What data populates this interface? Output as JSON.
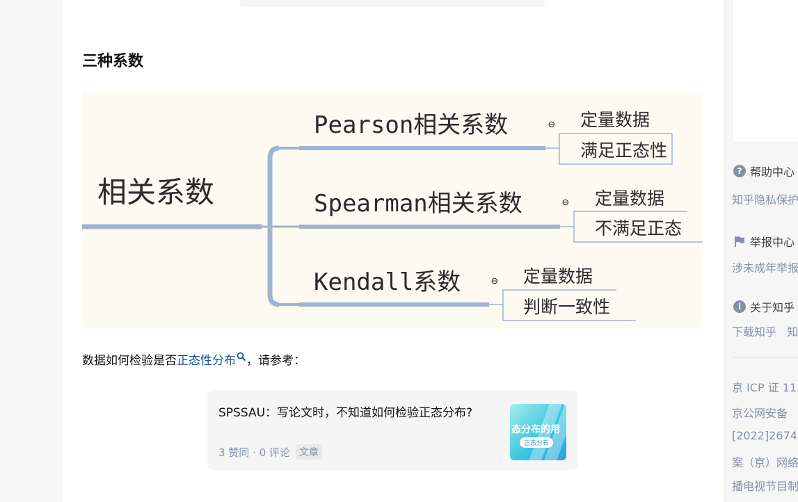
{
  "article": {
    "section_title": "三种系数",
    "mindmap": {
      "root": "相关系数",
      "branches": [
        {
          "label": "Pearson相关系数",
          "items": [
            "定量数据",
            "满足正态性"
          ]
        },
        {
          "label": "Spearman相关系数",
          "items": [
            "定量数据",
            "不满足正态"
          ]
        },
        {
          "label": "Kendall系数",
          "items": [
            "定量数据",
            "判断一致性"
          ]
        }
      ],
      "collapse_glyph": "⊖"
    },
    "paragraph": {
      "before_link": "数据如何检验是否",
      "link_text": "正态性分布",
      "after_link": "，请参考："
    },
    "ref_card": {
      "title": "SPSSAU：写论文时，不知道如何检验正态分布?",
      "meta": "3 赞同 · 0 评论",
      "tag": "文章",
      "thumb_text_main": "态分布的用",
      "thumb_text_sub": "正态分布"
    }
  },
  "sidebar": {
    "help_center": "帮助中心",
    "privacy_link": "知乎隐私保护",
    "report_center": "举报中心",
    "minor_link": "涉未成年举报",
    "about": "关于知乎",
    "download_links": [
      "下载知乎",
      "知"
    ],
    "footer_lines": [
      "京 ICP 证 11",
      "京公网安备",
      "[2022]2674",
      "案（京）网络",
      "播电视节目制"
    ]
  },
  "colors": {
    "link": "#175199",
    "meta_gray": "#8590a6",
    "mindmap_bg": "#fdfaf2",
    "mindmap_line": "#9fb4cf"
  }
}
